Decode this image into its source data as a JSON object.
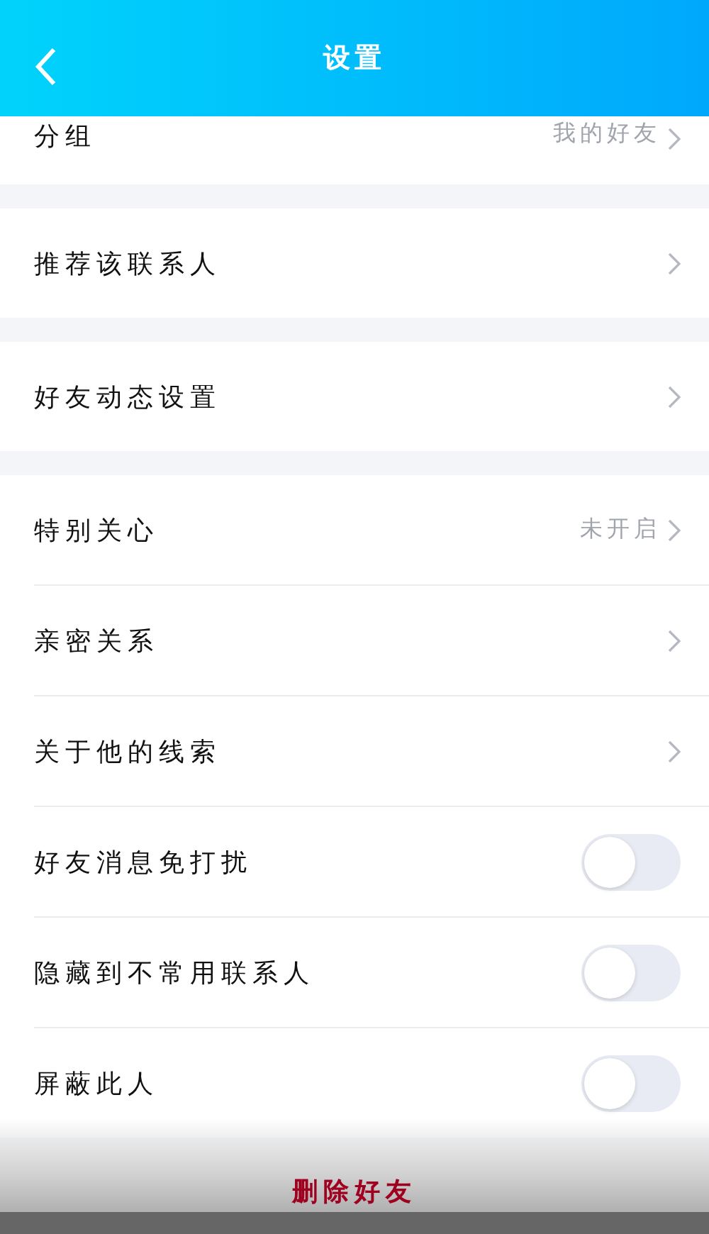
{
  "header": {
    "title": "设置"
  },
  "sections": [
    {
      "items": [
        {
          "kind": "link",
          "label": "分组",
          "value": "我的好友"
        }
      ]
    },
    {
      "items": [
        {
          "kind": "link",
          "label": "推荐该联系人"
        }
      ]
    },
    {
      "items": [
        {
          "kind": "link",
          "label": "好友动态设置"
        }
      ]
    },
    {
      "items": [
        {
          "kind": "link",
          "label": "特别关心",
          "value": "未开启"
        },
        {
          "kind": "link",
          "label": "亲密关系"
        },
        {
          "kind": "link",
          "label": "关于他的线索"
        },
        {
          "kind": "toggle",
          "label": "好友消息免打扰",
          "on": false
        },
        {
          "kind": "toggle",
          "label": "隐藏到不常用联系人",
          "on": false
        },
        {
          "kind": "toggle",
          "label": "屏蔽此人",
          "on": false
        }
      ]
    }
  ],
  "delete_button": {
    "label": "删除好友"
  }
}
